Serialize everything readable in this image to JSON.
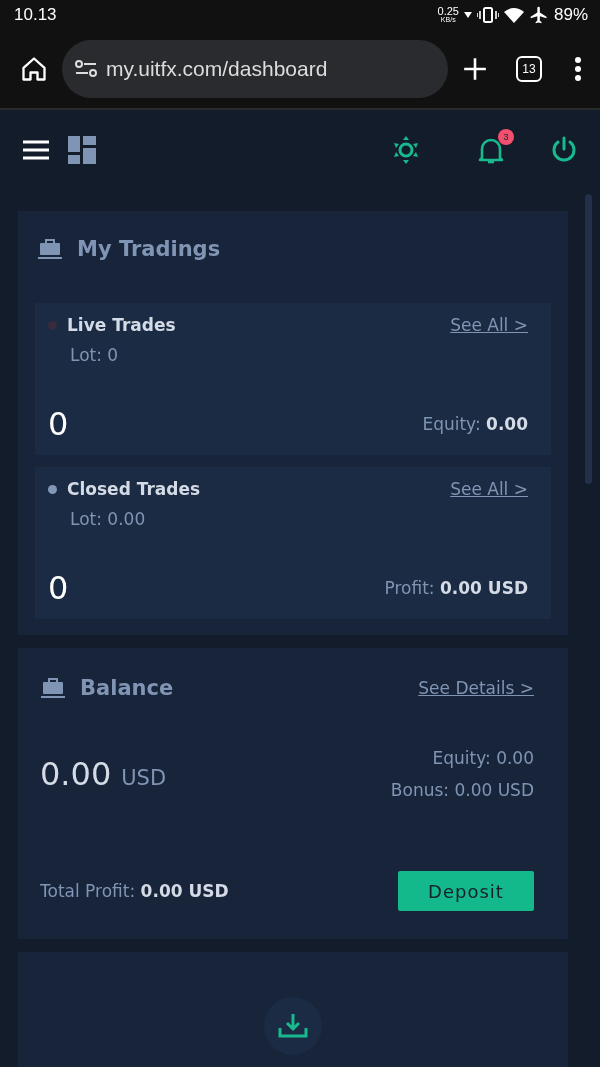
{
  "status_bar": {
    "time": "10.13",
    "speed": "0.25",
    "speed_unit": "KB/s",
    "battery": "89%"
  },
  "browser": {
    "url": "my.uitfx.com/dashboard",
    "tab_count": "13"
  },
  "nav": {
    "notification_count": "3"
  },
  "tradings": {
    "title": "My Tradings",
    "items": [
      {
        "title": "Live Trades",
        "color": "#3a2a3d",
        "link": "See All >",
        "lot": "Lot: 0",
        "count": "0",
        "stat": "Equity: **0.00**"
      },
      {
        "title": "Closed Trades",
        "color": "#8296b5",
        "link": "See All >",
        "lot": "Lot: 0.00",
        "count": "0",
        "stat": "Profit: **0.00 USD**"
      }
    ]
  },
  "balance": {
    "title": "Balance",
    "link": "See Details >",
    "amount": "0.00",
    "currency": "USD",
    "equity": "Equity: 0.00",
    "bonus": "Bonus: 0.00 USD",
    "total_profit": "Total Profit: **0.00 USD**",
    "button": "Deposit"
  }
}
